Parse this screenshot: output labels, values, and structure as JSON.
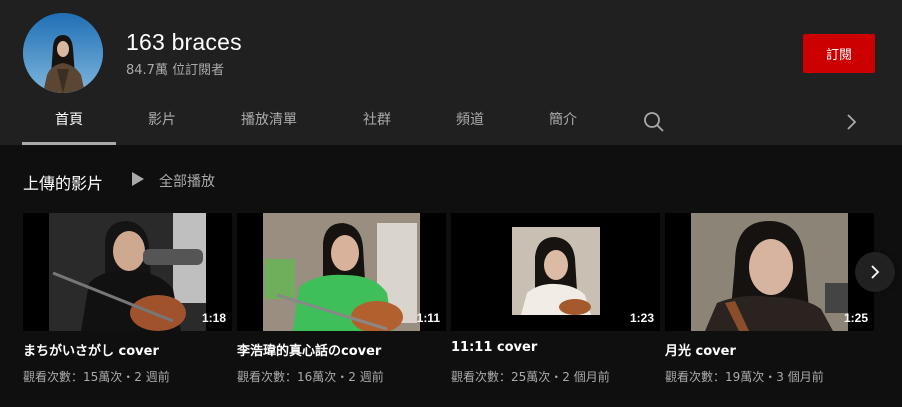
{
  "channel": {
    "name": "163 braces",
    "subscribers": "84.7萬 位訂閱者",
    "subscribe_label": "訂閱"
  },
  "tabs": [
    {
      "label": "首頁",
      "active": true
    },
    {
      "label": "影片"
    },
    {
      "label": "播放清單"
    },
    {
      "label": "社群"
    },
    {
      "label": "頻道"
    },
    {
      "label": "簡介"
    }
  ],
  "section": {
    "title": "上傳的影片",
    "play_all_label": "全部播放"
  },
  "videos": [
    {
      "title": "まちがいさがし cover",
      "duration": "1:18",
      "meta": "觀看次數：15萬次・2 週前"
    },
    {
      "title": "李浩瑋的真心話のcover",
      "duration": "1:11",
      "meta": "觀看次數：16萬次・2 週前"
    },
    {
      "title": "11:11 cover",
      "duration": "1:23",
      "meta": "觀看次數：25萬次・2 個月前"
    },
    {
      "title": "月光 cover",
      "duration": "1:25",
      "meta": "觀看次數：19萬次・3 個月前"
    }
  ],
  "icons": {
    "search": "search-icon",
    "tabs_next": "chevron-right-icon",
    "play": "play-icon",
    "shelf_next": "chevron-right-icon"
  },
  "colors": {
    "subscribe": "#cc0000",
    "header_bg": "#202020",
    "page_bg": "#0f0f0f"
  }
}
